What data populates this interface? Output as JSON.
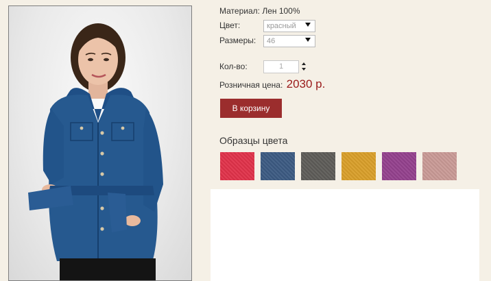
{
  "product": {
    "material_label": "Материал:",
    "material_value": "Лен 100%",
    "color_label": "Цвет:",
    "color_selected": "красный",
    "size_label": "Размеры:",
    "size_selected": "46",
    "qty_label": "Кол-во:",
    "qty_value": "1",
    "price_label": "Розничная цена:",
    "price_value": "2030 р.",
    "cart_button": "В корзину"
  },
  "swatches": {
    "title": "Образцы цвета",
    "colors": [
      "#e0324a",
      "#3c5a82",
      "#5e5c58",
      "#d99f2a",
      "#94418d",
      "#c99a96"
    ]
  }
}
